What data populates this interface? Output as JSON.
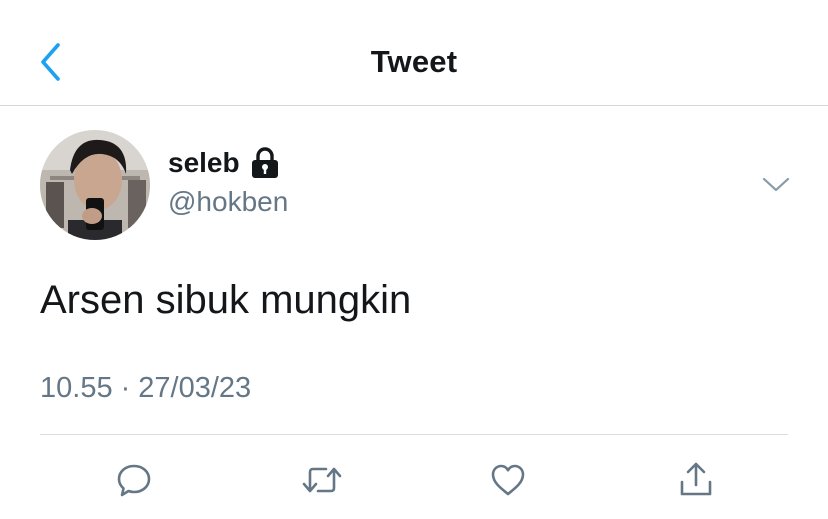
{
  "header": {
    "title": "Tweet",
    "back_icon": "chevron-left-icon",
    "accent_color": "#1da1f2"
  },
  "tweet": {
    "author": {
      "display_name": "seleb",
      "handle": "@hokben",
      "protected_icon": "lock-icon",
      "avatar": "avatar-photo"
    },
    "text": "Arsen sibuk mungkin",
    "time": "10.55",
    "separator": "·",
    "date": "27/03/23",
    "menu_icon": "chevron-down-icon"
  },
  "actions": [
    {
      "name": "reply",
      "icon": "comment-icon"
    },
    {
      "name": "retweet",
      "icon": "retweet-icon"
    },
    {
      "name": "like",
      "icon": "heart-icon"
    },
    {
      "name": "share",
      "icon": "share-icon"
    }
  ],
  "colors": {
    "text_primary": "#14171a",
    "text_secondary": "#657786",
    "divider": "#d9dde0",
    "icon_gray": "#657786"
  }
}
